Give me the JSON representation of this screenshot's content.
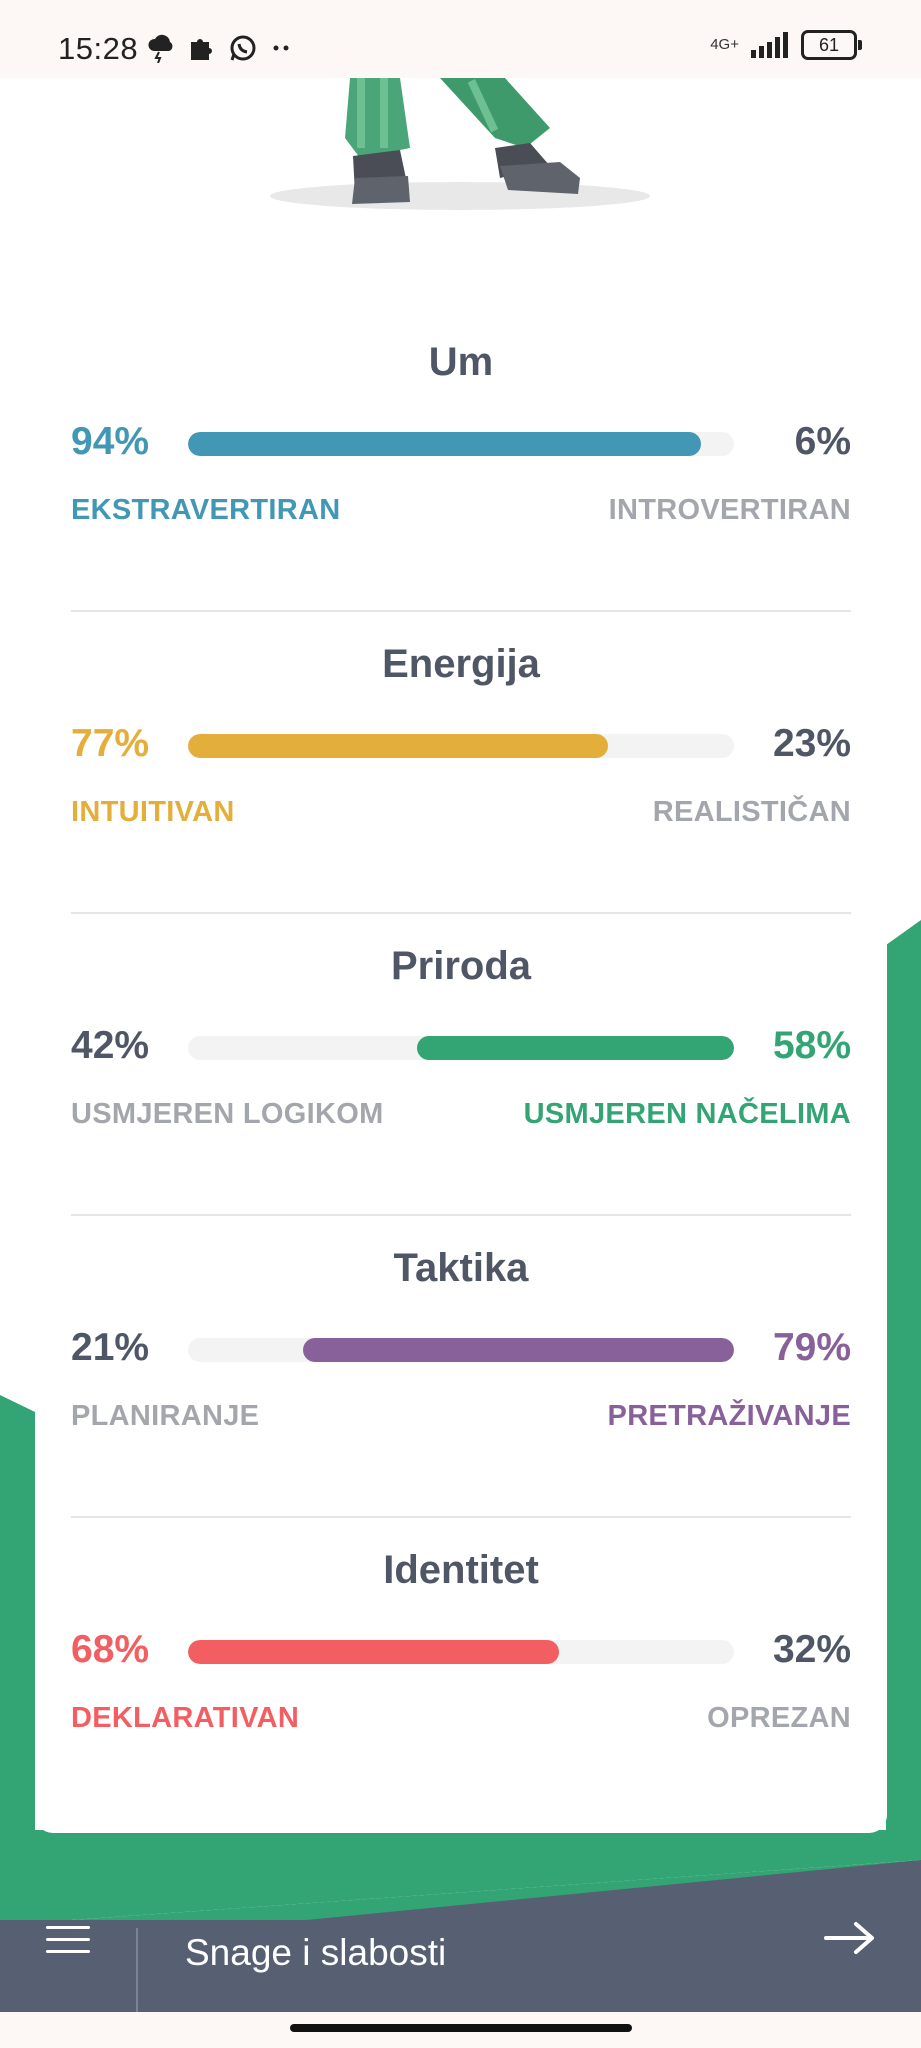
{
  "status": {
    "time": "15:28",
    "network": "4G+",
    "battery": "61"
  },
  "colors": {
    "green": "#33a474",
    "nav": "#566072",
    "text": "#4f5665",
    "muted": "#a3a6ad"
  },
  "traits": [
    {
      "title": "Um",
      "left_pct": "94%",
      "right_pct": "6%",
      "left_label": "EKSTRAVERTIRAN",
      "right_label": "INTROVERTIRAN",
      "dominant": "left",
      "fill": 0.94,
      "color": "#4298b4"
    },
    {
      "title": "Energija",
      "left_pct": "77%",
      "right_pct": "23%",
      "left_label": "INTUITIVAN",
      "right_label": "REALISTIČAN",
      "dominant": "left",
      "fill": 0.77,
      "color": "#e4ae3a"
    },
    {
      "title": "Priroda",
      "left_pct": "42%",
      "right_pct": "58%",
      "left_label": "USMJEREN LOGIKOM",
      "right_label": "USMJEREN NAČELIMA",
      "dominant": "right",
      "fill": 0.58,
      "color": "#33a474"
    },
    {
      "title": "Taktika",
      "left_pct": "21%",
      "right_pct": "79%",
      "left_label": "PLANIRANJE",
      "right_label": "PRETRAŽIVANJE",
      "dominant": "right",
      "fill": 0.79,
      "color": "#88619a"
    },
    {
      "title": "Identitet",
      "left_pct": "68%",
      "right_pct": "32%",
      "left_label": "DEKLARATIVAN",
      "right_label": "OPREZAN",
      "dominant": "left",
      "fill": 0.68,
      "color": "#f25e62"
    }
  ],
  "nav": {
    "title": "Snage i slabosti"
  }
}
